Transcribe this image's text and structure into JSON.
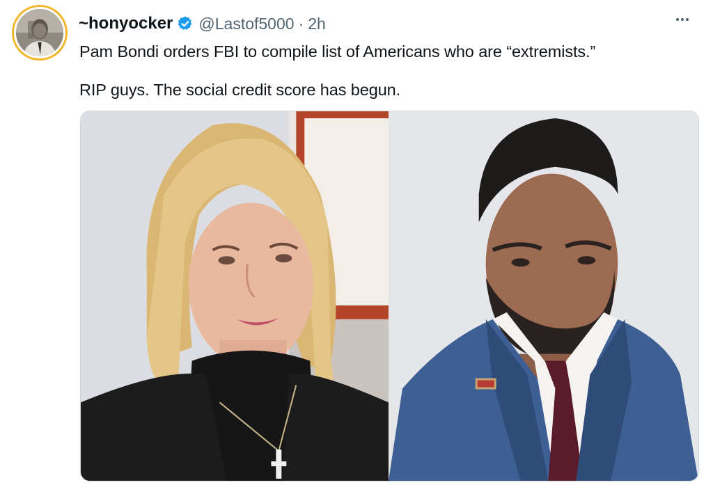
{
  "author": {
    "display_name": "~honyocker",
    "handle": "@Lastof5000",
    "separator": "·",
    "time": "2h",
    "avatar": "avatar-photo",
    "verified_icon": "verified-badge-icon",
    "colors": {
      "avatar_ring": "#f2b62a",
      "verified": "#1d9bf0"
    }
  },
  "tweet": {
    "line1": "Pam Bondi orders FBI to compile list of Americans who are “extremists.”",
    "line2": "RIP guys. The social credit score has begun."
  },
  "actions": {
    "more_icon": "more-options-icon"
  },
  "media": {
    "images": [
      {
        "subject": "woman-portrait-photo"
      },
      {
        "subject": "man-portrait-photo"
      }
    ]
  }
}
